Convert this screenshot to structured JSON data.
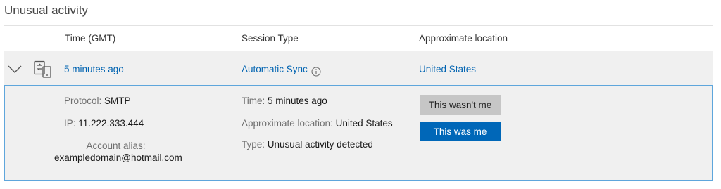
{
  "page": {
    "title": "Unusual activity"
  },
  "columns": {
    "time": "Time (GMT)",
    "session_type": "Session Type",
    "location": "Approximate location"
  },
  "activity": {
    "time": "5 minutes ago",
    "session_type": "Automatic Sync",
    "location": "United States",
    "device_icon": "sync-device-icon",
    "info_icon": "info-icon",
    "expand_icon": "chevron-down-icon"
  },
  "details": {
    "protocol_label": "Protocol:",
    "protocol_value": "SMTP",
    "ip_label": "IP:",
    "ip_value": "11.222.333.444",
    "alias_label": "Account alias:",
    "alias_value": "exampledomain@hotmail.com",
    "time_label": "Time:",
    "time_value": "5 minutes ago",
    "location_label": "Approximate location:",
    "location_value": "United States",
    "type_label": "Type:",
    "type_value": "Unusual activity detected"
  },
  "actions": {
    "not_me": "This wasn't me",
    "was_me": "This was me"
  },
  "colors": {
    "link": "#0063b1",
    "primary_button": "#0067b8",
    "secondary_button": "#c6c6c6",
    "row_background": "#f0f0f0",
    "detail_border": "#5ea6dc"
  }
}
